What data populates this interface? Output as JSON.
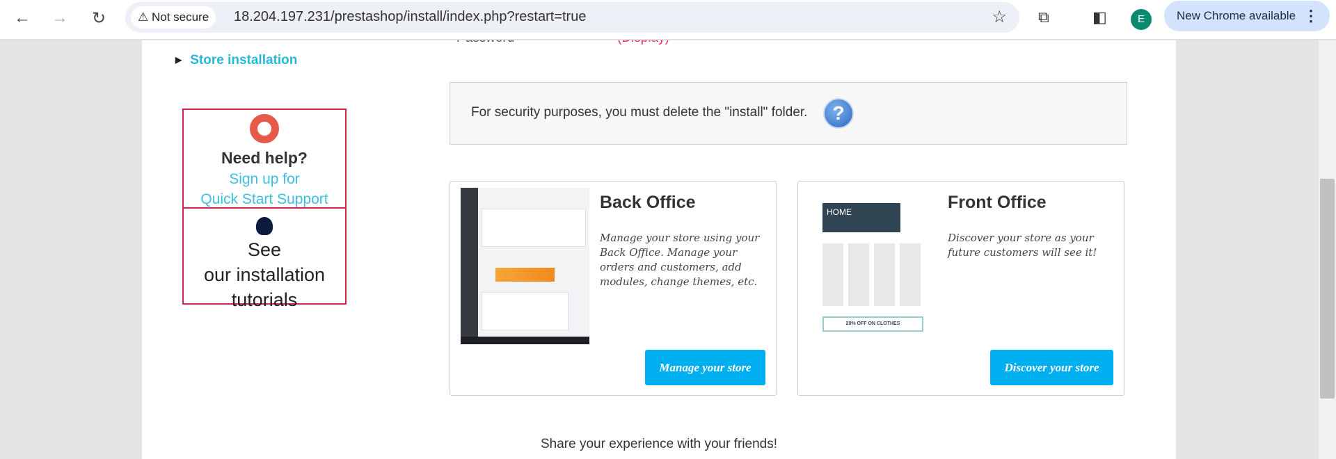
{
  "browser": {
    "security_label": "Not secure",
    "url": "18.204.197.231/prestashop/install/index.php?restart=true",
    "profile_initial": "E",
    "update_label": "New Chrome available"
  },
  "sidebar": {
    "step_label": "Store installation",
    "help": {
      "title": "Need help?",
      "link_line1": "Sign up for",
      "link_line2": "Quick Start Support"
    },
    "tutorials": {
      "line1": "See",
      "line2": "our installation",
      "line3": "tutorials"
    }
  },
  "main": {
    "password_label": "Password",
    "password_display": "(Display)",
    "security_notice": "For security purposes, you must delete the \"install\" folder.",
    "back_office": {
      "title": "Back Office",
      "description": "Manage your store using your Back Office. Manage your orders and customers, add modules, change themes, etc.",
      "button": "Manage your store"
    },
    "front_office": {
      "title": "Front Office",
      "description": "Discover your store as your future customers will see it!",
      "button": "Discover your store",
      "thumb_banner": "HOME",
      "thumb_promo": "20% OFF ON CLOTHES"
    },
    "share_text": "Share your experience with your friends!"
  },
  "colors": {
    "accent": "#25b9d7",
    "button": "#00aff0",
    "help_border": "#d0284c"
  }
}
